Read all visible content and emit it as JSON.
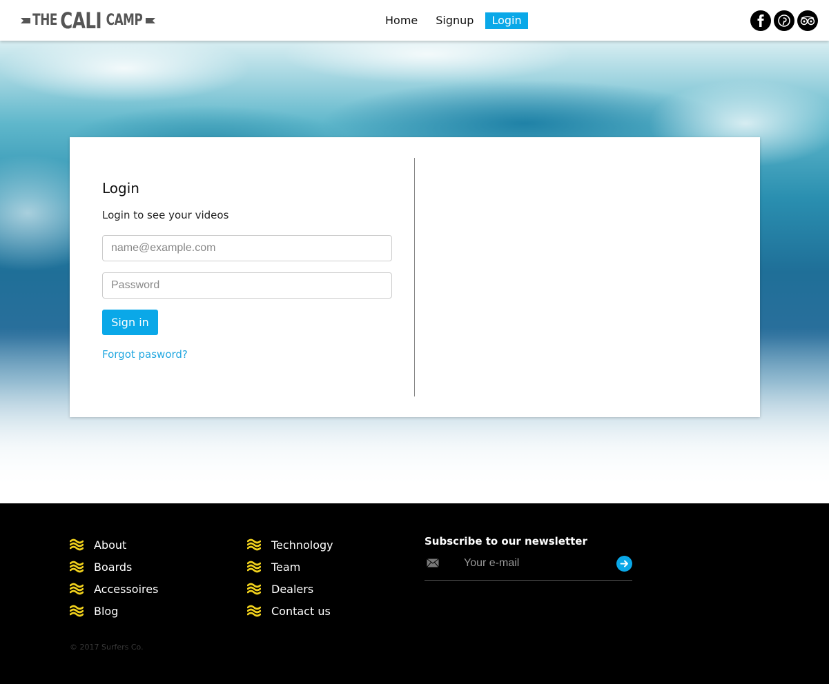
{
  "header": {
    "logo": {
      "pre": "THE",
      "main": "CALI",
      "post": "CAMP"
    },
    "nav": [
      {
        "label": "Home",
        "active": false
      },
      {
        "label": "Signup",
        "active": false
      },
      {
        "label": "Login",
        "active": true
      }
    ],
    "social": [
      "facebook-icon",
      "pinterest-icon",
      "tripadvisor-icon"
    ]
  },
  "login": {
    "title": "Login",
    "subtitle": "Login to see your videos",
    "email_placeholder": "name@example.com",
    "password_placeholder": "Password",
    "submit_label": "Sign in",
    "forgot_label": "Forgot pasword?"
  },
  "footer": {
    "col1": [
      "About",
      "Boards",
      "Accessoires",
      "Blog"
    ],
    "col2": [
      "Technology",
      "Team",
      "Dealers",
      "Contact us"
    ],
    "newsletter": {
      "title": "Subscribe to our newsletter",
      "placeholder": "Your e-mail"
    },
    "copyright": "© 2017 Surfers Co."
  },
  "colors": {
    "accent": "#0aa8e8",
    "wave_icon": "#f2d21c",
    "footer_bg": "#000000"
  }
}
